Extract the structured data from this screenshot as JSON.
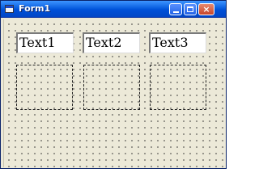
{
  "window": {
    "title": "Form1",
    "icon": "vb-form-icon",
    "buttons": {
      "minimize": "minimize-icon",
      "maximize": "maximize-icon",
      "close": "close-icon",
      "close_glyph": "×"
    }
  },
  "form": {
    "textboxes": [
      {
        "text": "Text1"
      },
      {
        "text": "Text2"
      },
      {
        "text": "Text3"
      }
    ],
    "frames": 3
  }
}
